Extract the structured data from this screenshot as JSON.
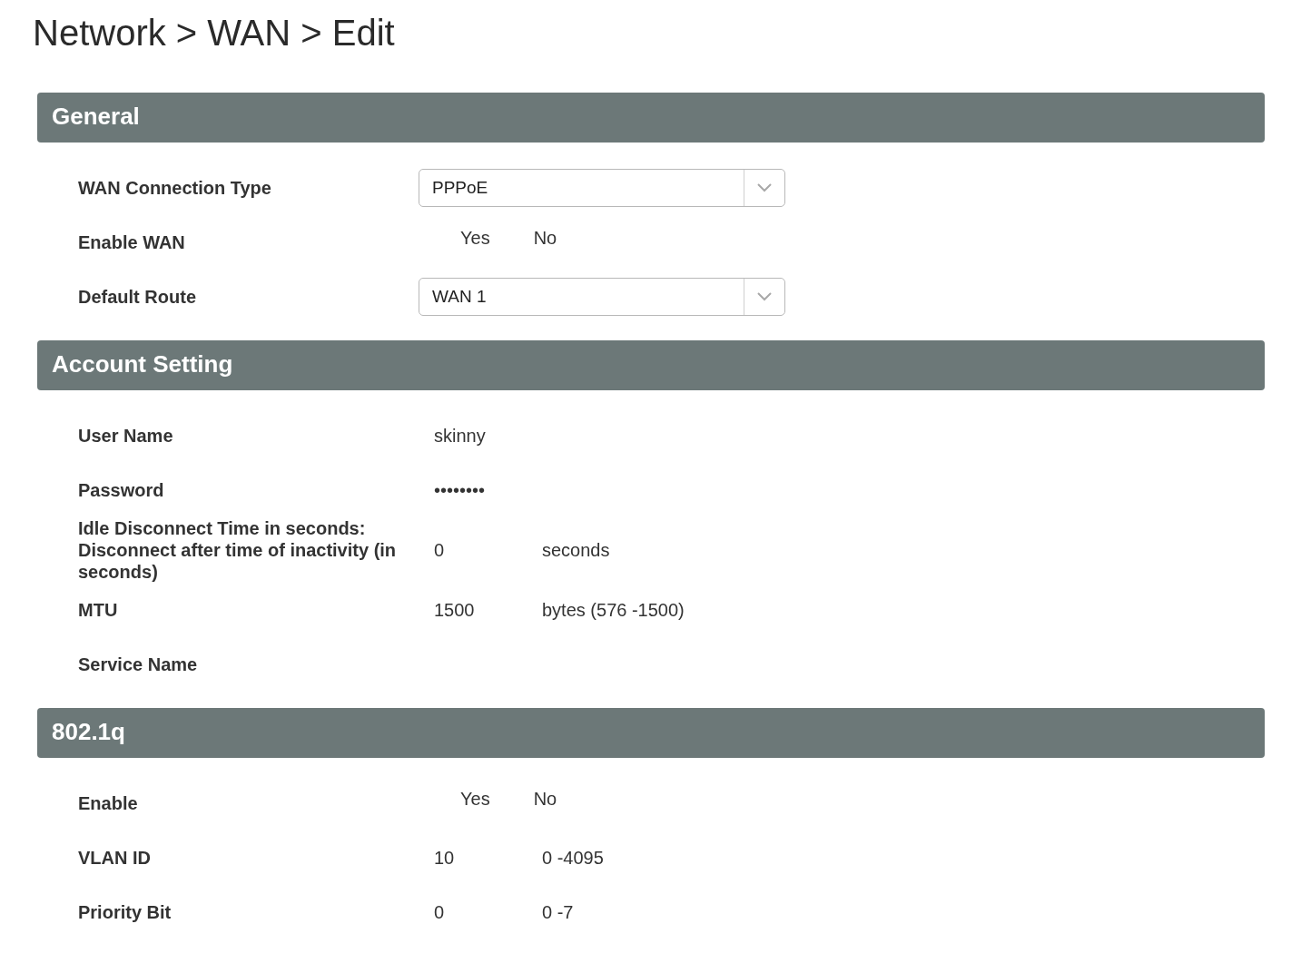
{
  "title": "Network > WAN > Edit",
  "sections": [
    {
      "heading": "General",
      "rows": [
        {
          "label": "WAN Connection Type",
          "kind": "select",
          "value": "PPPoE"
        },
        {
          "label": "Enable WAN",
          "kind": "options",
          "options": [
            "Yes",
            "No"
          ]
        },
        {
          "label": "Default Route",
          "kind": "select",
          "value": "WAN 1"
        }
      ]
    },
    {
      "heading": "Account Setting",
      "rows": [
        {
          "label": "User Name",
          "kind": "text",
          "value": "skinny"
        },
        {
          "label": "Password",
          "kind": "text",
          "value": "••••••••"
        },
        {
          "label": "Idle Disconnect Time in seconds: Disconnect after time of inactivity (in seconds)",
          "kind": "text",
          "value": "0",
          "unit": "seconds"
        },
        {
          "label": "MTU",
          "kind": "text",
          "value": "1500",
          "unit": "bytes (576 -1500)"
        },
        {
          "label": "Service Name",
          "kind": "text"
        }
      ]
    },
    {
      "heading": "802.1q",
      "rows": [
        {
          "label": "Enable",
          "kind": "options",
          "options": [
            "Yes",
            "No"
          ]
        },
        {
          "label": "VLAN ID",
          "kind": "text",
          "value": "10",
          "unit": "0 -4095"
        },
        {
          "label": "Priority Bit",
          "kind": "text",
          "value": "0",
          "unit": "0 -7"
        }
      ]
    }
  ]
}
